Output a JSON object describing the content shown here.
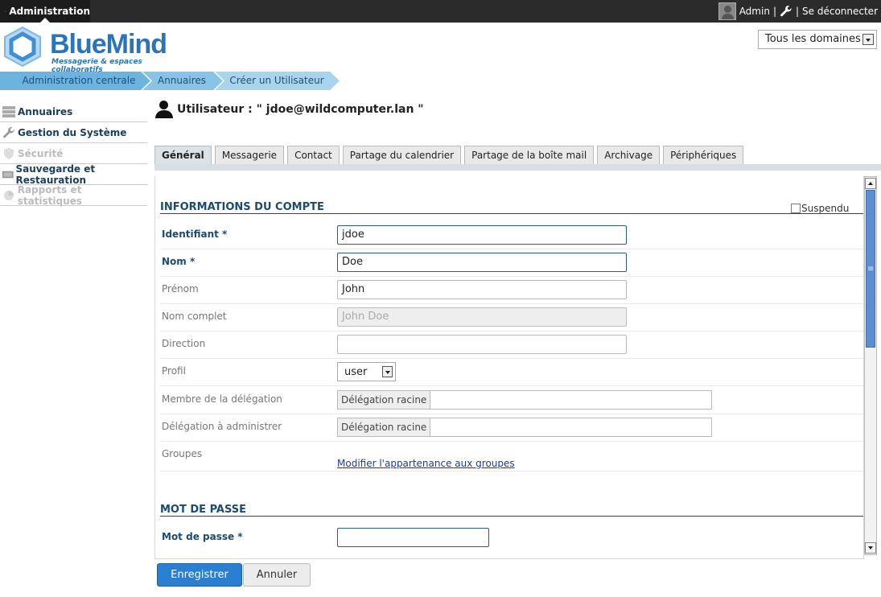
{
  "topbar": {
    "app_title": "Administration",
    "user_name": "Admin",
    "sep1": "|",
    "sep2": "|",
    "logout": "Se déconnecter"
  },
  "logo": {
    "brand": "BlueMind",
    "tagline": "Messagerie & espaces collaboratifs"
  },
  "domain_select": {
    "value": "Tous les domaines"
  },
  "breadcrumb": [
    "Administration centrale",
    "Annuaires",
    "Créer un Utilisateur"
  ],
  "sidebar": {
    "items": [
      {
        "label": "Annuaires",
        "icon": "directory-icon",
        "enabled": true
      },
      {
        "label": "Gestion du Système",
        "icon": "wrench-icon",
        "enabled": true
      },
      {
        "label": "Sécurité",
        "icon": "shield-icon",
        "enabled": false
      },
      {
        "label": "Sauvegarde et Restauration",
        "icon": "backup-drive-icon",
        "enabled": true
      },
      {
        "label": "Rapports et statistiques",
        "icon": "chart-icon",
        "enabled": false
      }
    ]
  },
  "page_title": "Utilisateur : \" jdoe@wildcomputer.lan \"",
  "tabs": [
    "Général",
    "Messagerie",
    "Contact",
    "Partage du calendrier",
    "Partage de la boîte mail",
    "Archivage",
    "Périphériques"
  ],
  "form": {
    "section_account": "INFORMATIONS DU COMPTE",
    "suspend_label": "Suspendu",
    "login_label": "Identifiant *",
    "login_value": "jdoe",
    "lastname_label": "Nom *",
    "lastname_value": "Doe",
    "firstname_label": "Prénom",
    "firstname_value": "John",
    "fullname_label": "Nom complet",
    "fullname_value": "John Doe",
    "direction_label": "Direction",
    "direction_value": "",
    "profile_label": "Profil",
    "profile_value": "user",
    "member_deleg_label": "Membre de la délégation",
    "member_deleg_prefix": "Délégation racine",
    "admin_deleg_label": "Délégation à administrer",
    "admin_deleg_prefix": "Délégation racine",
    "groups_label": "Groupes",
    "groups_link": "Modifier l'appartenance aux groupes",
    "section_password": "MOT DE PASSE",
    "password_label": "Mot de passe *",
    "password_value": ""
  },
  "buttons": {
    "save": "Enregistrer",
    "cancel": "Annuler"
  },
  "colors": {
    "accent": "#2a7fd0",
    "section": "#1c4a73",
    "breadcrumb_active": "#6db3e0",
    "breadcrumb_inactive": "#a9d4ee"
  }
}
